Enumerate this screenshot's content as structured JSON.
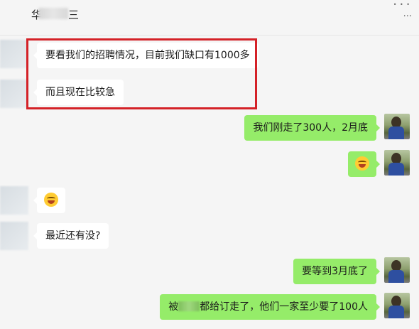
{
  "header": {
    "title_visible_fragment": "华",
    "title_fragment_end": "三",
    "dots": "• • •",
    "more": "···"
  },
  "messages": [
    {
      "side": "left",
      "text": "要看我们的招聘情况，目前我们缺口有1000多"
    },
    {
      "side": "left",
      "text": "而且现在比较急"
    },
    {
      "side": "right",
      "text": "我们刚走了300人，2月底"
    },
    {
      "side": "right",
      "emoji": "grin-sweat-emoji"
    },
    {
      "side": "left",
      "emoji": "tears-of-joy-emoji"
    },
    {
      "side": "left",
      "text": "最近还有没?"
    },
    {
      "side": "right",
      "text": "要等到3月底了"
    },
    {
      "side": "right",
      "text_before": "被",
      "text_after": "都给订走了，他们一家至少要了100人"
    }
  ],
  "colors": {
    "background": "#f5f5f5",
    "bubble_self": "#95ec69",
    "bubble_other": "#ffffff",
    "highlight": "#d42127"
  }
}
